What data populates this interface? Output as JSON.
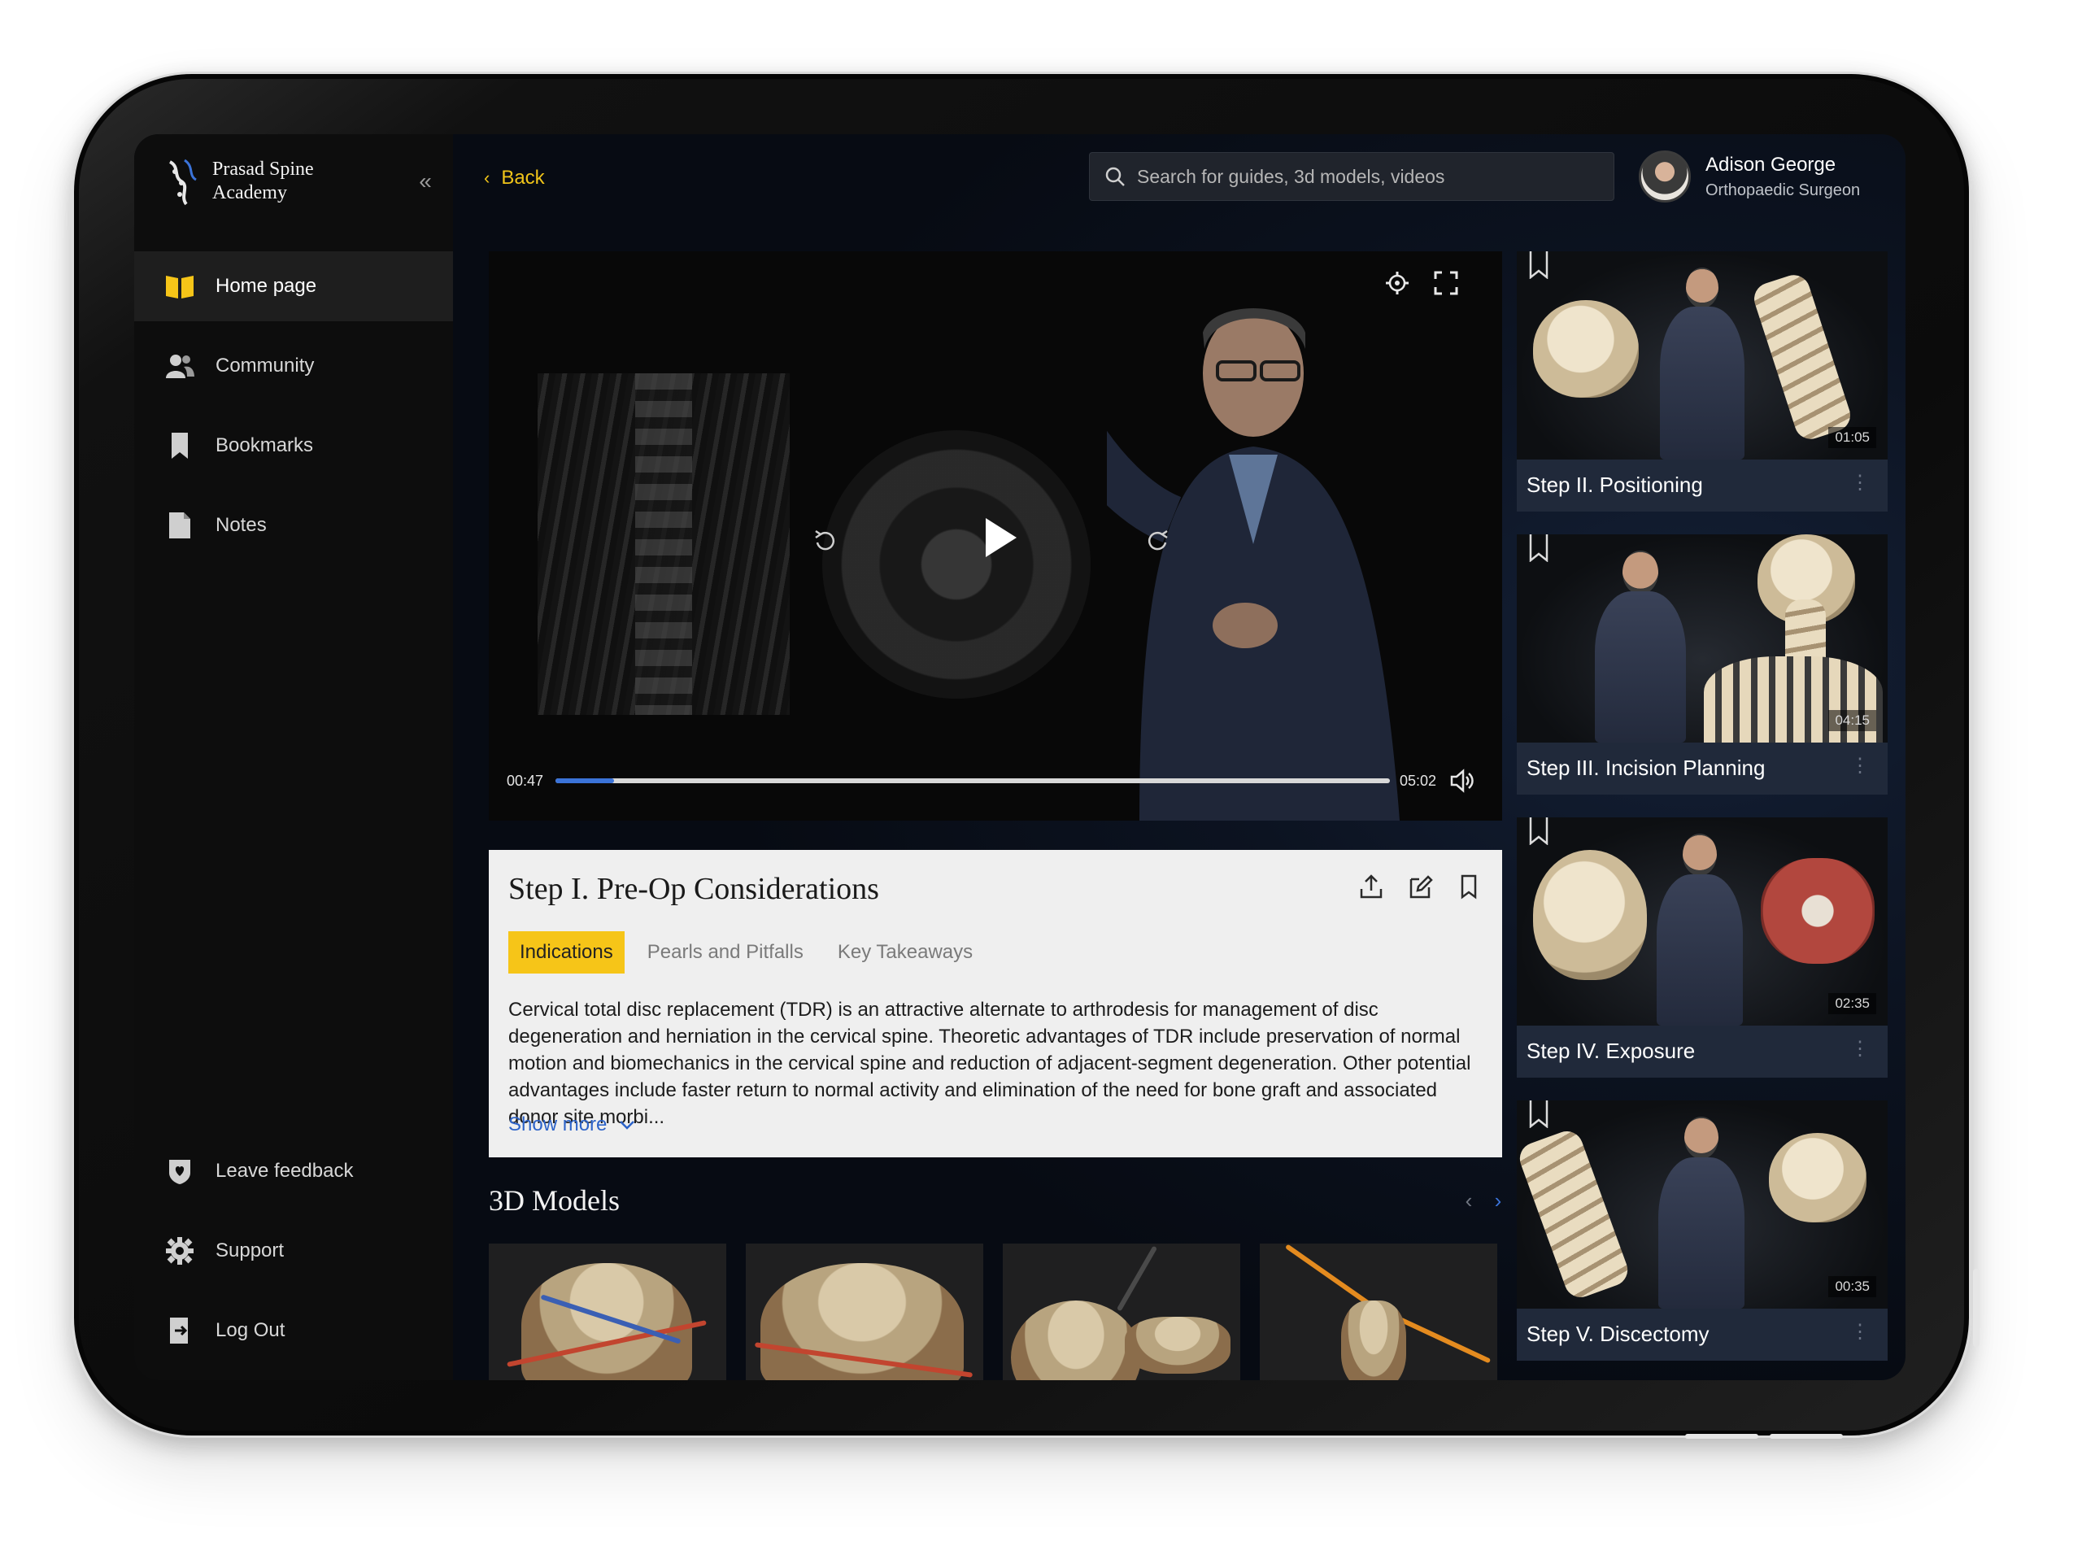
{
  "app": {
    "name": "Prasad Spine Academy"
  },
  "sidebar": {
    "items": [
      {
        "label": "Home page",
        "icon": "book-open-icon",
        "active": true
      },
      {
        "label": "Community",
        "icon": "users-icon",
        "active": false
      },
      {
        "label": "Bookmarks",
        "icon": "bookmark-icon",
        "active": false
      },
      {
        "label": "Notes",
        "icon": "note-icon",
        "active": false
      }
    ],
    "bottom_items": [
      {
        "label": "Leave feedback",
        "icon": "heart-shield-icon"
      },
      {
        "label": "Support",
        "icon": "gear-icon"
      },
      {
        "label": "Log Out",
        "icon": "logout-icon"
      }
    ]
  },
  "header": {
    "back_label": "Back",
    "search_placeholder": "Search for guides, 3d models, videos",
    "user": {
      "name": "Adison George",
      "role": "Orthopaedic Surgeon"
    }
  },
  "video": {
    "current_time": "00:47",
    "duration": "05:02",
    "progress_fraction": 0.07
  },
  "lesson": {
    "title": "Step I. Pre-Op Considerations",
    "tabs": [
      "Indications",
      "Pearls and Pitfalls",
      "Key Takeaways"
    ],
    "active_tab": "Indications",
    "description": "Cervical total disc replacement (TDR) is an attractive alternate to arthrodesis for management of disc degeneration and herniation in the cervical spine. Theoretic advantages of TDR include preservation of normal motion and biomechanics in the cervical spine and reduction of adjacent-segment degeneration. Other potential advantages include faster return to normal activity and elimination of the need for bone graft and associated donor site morbi...",
    "show_more_label": "Show more"
  },
  "models": {
    "title": "3D Models"
  },
  "steps": [
    {
      "prefix": "Step II.",
      "name": "Positioning",
      "duration": "01:05"
    },
    {
      "prefix": "Step III.",
      "name": "Incision Planning",
      "duration": "04:15"
    },
    {
      "prefix": "Step IV.",
      "name": "Exposure",
      "duration": "02:35"
    },
    {
      "prefix": "Step V.",
      "name": "Discectomy",
      "duration": "00:35"
    }
  ],
  "colors": {
    "accent_yellow": "#f6c518",
    "accent_blue": "#3b73d8",
    "sidebar_bg": "#0d0d0d",
    "card_bg": "#efefef"
  }
}
